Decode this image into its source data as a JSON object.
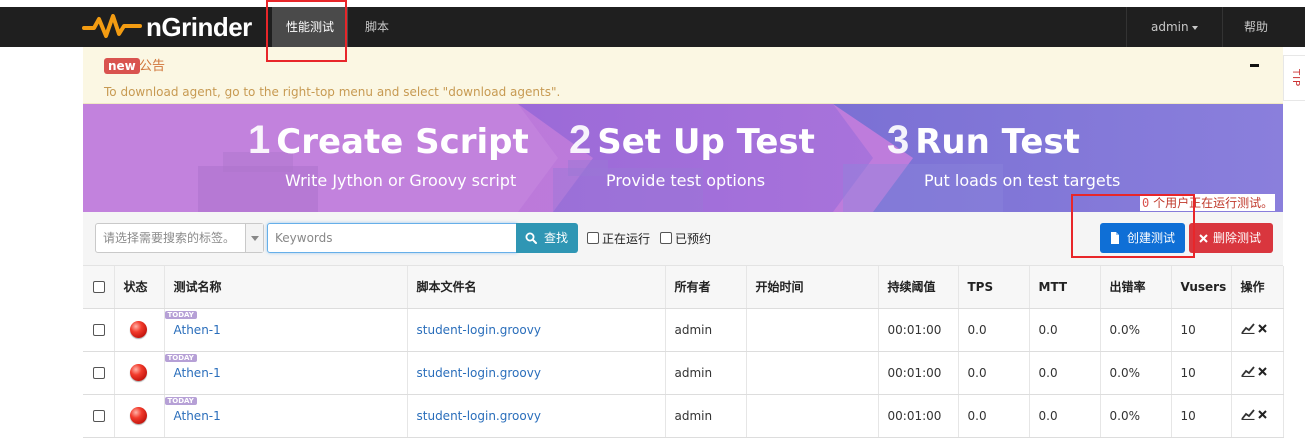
{
  "nav": {
    "logo": "nGrinder",
    "items": [
      {
        "label": "性能测试",
        "active": true
      },
      {
        "label": "脚本",
        "active": false
      }
    ],
    "user": "admin",
    "help": "帮助"
  },
  "notice": {
    "badge": "new",
    "title": "公告",
    "text": "To download agent, go to the right-top menu and select \"download agents\".",
    "tip": "TIP"
  },
  "banner": {
    "steps": [
      {
        "num": "1",
        "title": "Create Script",
        "subtitle": "Write Jython or Groovy script"
      },
      {
        "num": "2",
        "title": "Set Up Test",
        "subtitle": "Provide test options"
      },
      {
        "num": "3",
        "title": "Run Test",
        "subtitle": "Put loads on test targets"
      }
    ]
  },
  "running_note": {
    "count": "0",
    "text": "个用户正在运行测试。"
  },
  "toolbar": {
    "tag_placeholder": "请选择需要搜索的标签。",
    "search_placeholder": "Keywords",
    "search_button": "查找",
    "filter_running": "正在运行",
    "filter_scheduled": "已预约",
    "create_button": "创建测试",
    "delete_button": "删除测试"
  },
  "table": {
    "headers": [
      "",
      "状态",
      "测试名称",
      "脚本文件名",
      "所有者",
      "开始时间",
      "持续阈值",
      "TPS",
      "MTT",
      "出错率",
      "Vusers",
      "操作"
    ],
    "today_badge": "TODAY",
    "rows": [
      {
        "name": "Athen-1",
        "script": "student-login.groovy",
        "owner": "admin",
        "start": "",
        "duration": "00:01:00",
        "tps": "0.0",
        "mtt": "0.0",
        "error": "0.0%",
        "vusers": "10"
      },
      {
        "name": "Athen-1",
        "script": "student-login.groovy",
        "owner": "admin",
        "start": "",
        "duration": "00:01:00",
        "tps": "0.0",
        "mtt": "0.0",
        "error": "0.0%",
        "vusers": "10"
      },
      {
        "name": "Athen-1",
        "script": "student-login.groovy",
        "owner": "admin",
        "start": "",
        "duration": "00:01:00",
        "tps": "0.0",
        "mtt": "0.0",
        "error": "0.0%",
        "vusers": "10"
      }
    ]
  },
  "icons": {
    "status": "status-red-ball-icon",
    "chart": "chart-icon",
    "delete": "close-icon",
    "search": "search-icon",
    "file": "file-icon"
  },
  "colors": {
    "navbar": "#1f1f1f",
    "create_button": "#0f6fd6",
    "delete_button": "#d9363e",
    "search_button": "#2f96b4",
    "annotation": "#e8262a"
  }
}
